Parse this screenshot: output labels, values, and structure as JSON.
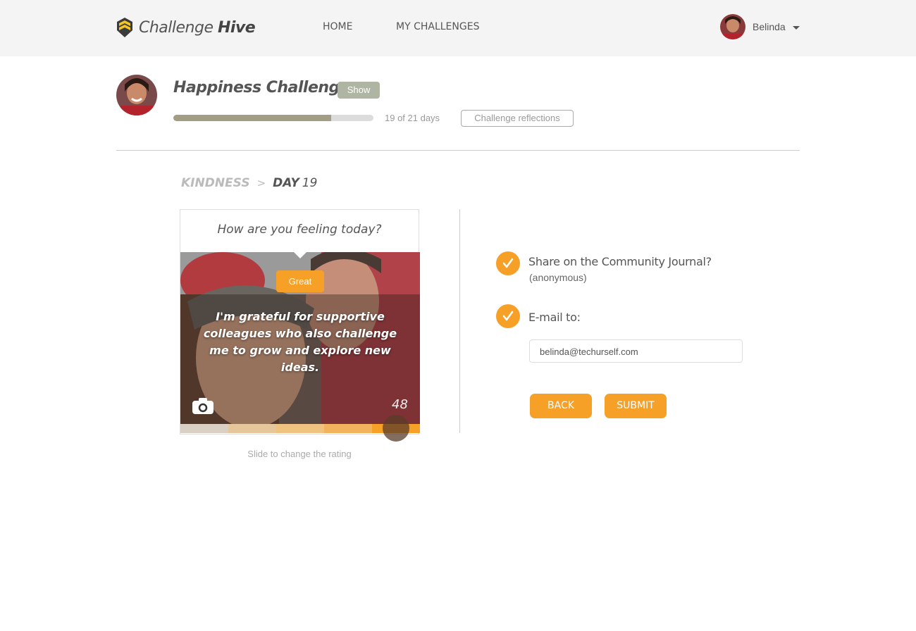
{
  "app": {
    "brand_regular": "Challenge",
    "brand_bold": "Hive"
  },
  "nav": {
    "home": "HOME",
    "my_challenges": "MY CHALLENGES"
  },
  "user": {
    "name": "Belinda"
  },
  "challenge": {
    "title": "Happiness Challenge",
    "show_label": "Show",
    "progress_fraction": 0.79,
    "days_text": "19 of 21 days",
    "reflections_label": "Challenge reflections"
  },
  "breadcrumb": {
    "category": "KINDNESS",
    "separator": ">",
    "day_label": "DAY",
    "day_number": "19"
  },
  "card": {
    "question": "How are you feeling today?",
    "mood": "Great",
    "quote": "I'm grateful for supportive colleagues who also challenge me to grow and explore new ideas.",
    "count": "48",
    "scale_colors": [
      "#d9cfc2",
      "#e6c79c",
      "#f0c27f",
      "#f2b35c",
      "#f6a028"
    ],
    "slide_hint": "Slide to change the rating"
  },
  "form": {
    "share_label": "Share on the Community Journal?",
    "share_sub": "(anonymous)",
    "email_label": "E-mail to:",
    "email_value": "belinda@techurself.com",
    "back_label": "BACK",
    "submit_label": "SUBMIT"
  },
  "colors": {
    "accent": "#f6a028",
    "badge": "#aeb5a2",
    "progress": "#a39d86"
  }
}
